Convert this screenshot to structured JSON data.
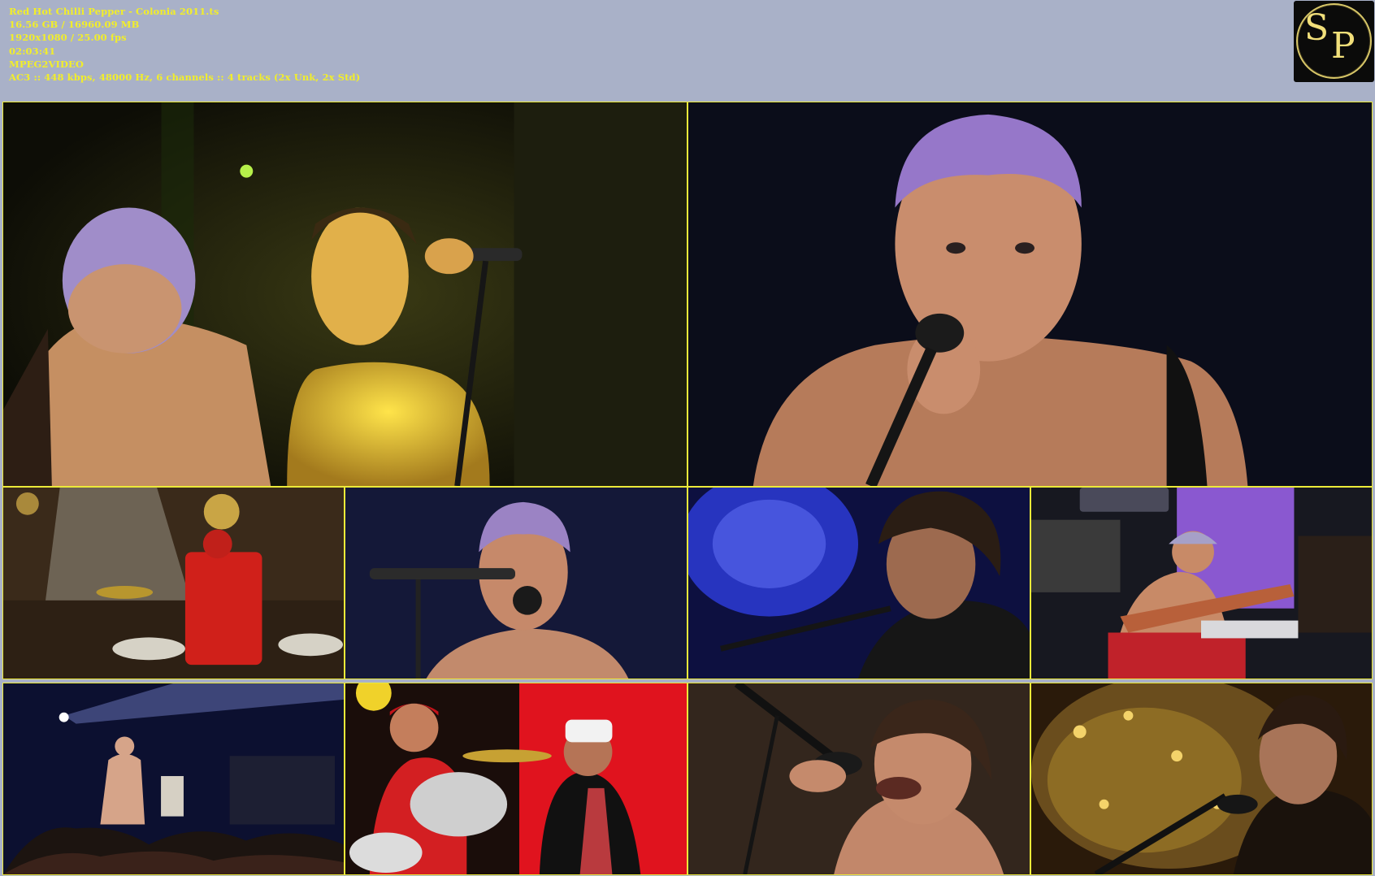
{
  "file_info": {
    "filename": "Red Hot Chilli Pepper - Colonia 2011.ts",
    "size": "16.56 GB / 16960.09 MB",
    "video": "1920x1080 / 25.00 fps",
    "duration": "02:03:41",
    "codec": "MPEG2VIDEO",
    "audio": "AC3 :: 448 kbps, 48000 Hz, 6 channels :: 4 tracks (2x Unk, 2x Std)"
  },
  "logo": {
    "letter_1": "S",
    "letter_2": "P"
  },
  "colors": {
    "background": "#a9b1c8",
    "info_text": "#f2ee2a",
    "thumb_border": "#ecea39"
  },
  "thumbnails": [
    {
      "scene": "two-singers-yellow-light"
    },
    {
      "scene": "bassist-closeup-microphone"
    },
    {
      "scene": "drummer-wide-stage"
    },
    {
      "scene": "bassist-singing-blue"
    },
    {
      "scene": "guitarist-blue-chandelier"
    },
    {
      "scene": "bassist-playing-bass"
    },
    {
      "scene": "stage-wide-crowd"
    },
    {
      "scene": "drummer-and-singer-red"
    },
    {
      "scene": "singer-closeup"
    },
    {
      "scene": "guitarist-gold-chandelier"
    }
  ]
}
